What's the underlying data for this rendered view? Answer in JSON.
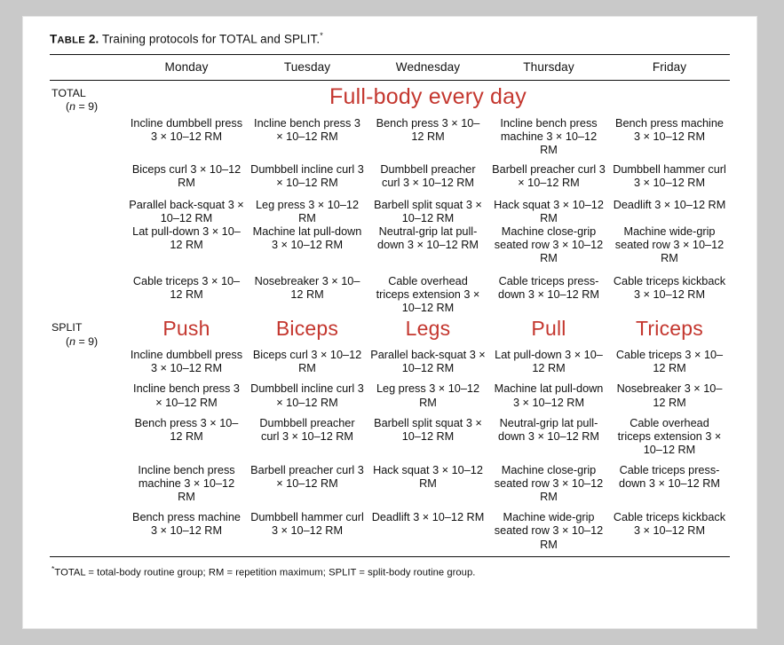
{
  "table": {
    "number_label": "TABLE 2.",
    "number_prefix": "T",
    "number_smallcaps": "ABLE",
    "number_suffix": " 2.",
    "caption": "Training protocols for TOTAL and SPLIT.",
    "caption_marker": "*",
    "footnote_marker": "*",
    "footnote": "TOTAL = total-body routine group; RM = repetition maximum; SPLIT = split-body routine group.",
    "accent_color": "#c4372f",
    "text_color": "#111111",
    "page_background": "#c9c9c9",
    "sheet_background": "#ffffff"
  },
  "columns": {
    "label_header": "",
    "days": [
      "Monday",
      "Tuesday",
      "Wednesday",
      "Thursday",
      "Friday"
    ]
  },
  "groups": [
    {
      "id": "total",
      "name": "TOTAL",
      "n_label": "(n = 9)",
      "n_italic": "n",
      "n_rest": " = 9)",
      "n_open": "(",
      "banner": "Full-body every day",
      "banner_is_red": true,
      "day_headers": [],
      "blocks": [
        {
          "rows": [
            [
              "Incline dumbbell press 3 × 10–12 RM",
              "Incline bench press 3 × 10–12 RM",
              "Bench press 3 × 10–12 RM",
              "Incline bench press machine 3 × 10–12 RM",
              "Bench press machine 3 × 10–12 RM"
            ],
            [
              "Biceps curl 3 × 10–12 RM",
              "Dumbbell incline curl 3 × 10–12 RM",
              "Dumbbell preacher curl 3 × 10–12 RM",
              "Barbell preacher curl 3 × 10–12 RM",
              "Dumbbell hammer curl 3 × 10–12 RM"
            ]
          ]
        },
        {
          "rows": [
            [
              "Parallel back-squat 3 × 10–12 RM",
              "Leg press 3 × 10–12 RM",
              "Barbell split squat 3 × 10–12 RM",
              "Hack squat 3 × 10–12 RM",
              "Deadlift 3 × 10–12 RM"
            ],
            [
              "Lat pull-down 3 × 10–12 RM",
              "Machine lat pull-down 3 × 10–12 RM",
              "Neutral-grip lat pull-down 3 × 10–12 RM",
              "Machine close-grip seated row 3 × 10–12 RM",
              "Machine wide-grip seated row 3 × 10–12 RM"
            ]
          ]
        },
        {
          "rows": [
            [
              "Cable triceps 3 × 10–12 RM",
              "Nosebreaker 3 × 10–12 RM",
              "Cable overhead triceps extension 3 × 10–12 RM",
              "Cable triceps press-down 3 × 10–12 RM",
              "Cable triceps kickback 3 × 10–12 RM"
            ]
          ]
        }
      ]
    },
    {
      "id": "split",
      "name": "SPLIT",
      "n_label": "(n = 9)",
      "n_italic": "n",
      "n_rest": " = 9)",
      "n_open": "(",
      "banner": "",
      "banner_is_red": false,
      "day_headers": [
        "Push",
        "Biceps",
        "Legs",
        "Pull",
        "Triceps"
      ],
      "blocks": [
        {
          "rows": [
            [
              "Incline dumbbell press 3 × 10–12 RM",
              "Biceps curl 3 × 10–12 RM",
              "Parallel back-squat 3 × 10–12 RM",
              "Lat pull-down 3 × 10–12 RM",
              "Cable triceps 3 × 10–12 RM"
            ]
          ]
        },
        {
          "rows": [
            [
              "Incline bench press 3 × 10–12 RM",
              "Dumbbell incline curl 3 × 10–12 RM",
              "Leg press 3 × 10–12 RM",
              "Machine lat pull-down 3 × 10–12 RM",
              "Nosebreaker 3 × 10–12 RM"
            ]
          ]
        },
        {
          "rows": [
            [
              "Bench press 3 × 10–12 RM",
              "Dumbbell preacher curl 3 × 10–12 RM",
              "Barbell split squat 3 × 10–12 RM",
              "Neutral-grip lat pull-down 3 × 10–12 RM",
              "Cable overhead triceps extension 3 × 10–12 RM"
            ]
          ]
        },
        {
          "rows": [
            [
              "Incline bench press machine 3 × 10–12 RM",
              "Barbell preacher curl 3 × 10–12 RM",
              "Hack squat 3 × 10–12 RM",
              "Machine close-grip seated row 3 × 10–12 RM",
              "Cable triceps press-down 3 × 10–12 RM"
            ]
          ]
        },
        {
          "rows": [
            [
              "Bench press machine 3 × 10–12 RM",
              "Dumbbell hammer curl 3 × 10–12 RM",
              "Deadlift 3 × 10–12 RM",
              "Machine wide-grip seated row 3 × 10–12 RM",
              "Cable triceps kickback 3 × 10–12 RM"
            ]
          ]
        }
      ]
    }
  ]
}
